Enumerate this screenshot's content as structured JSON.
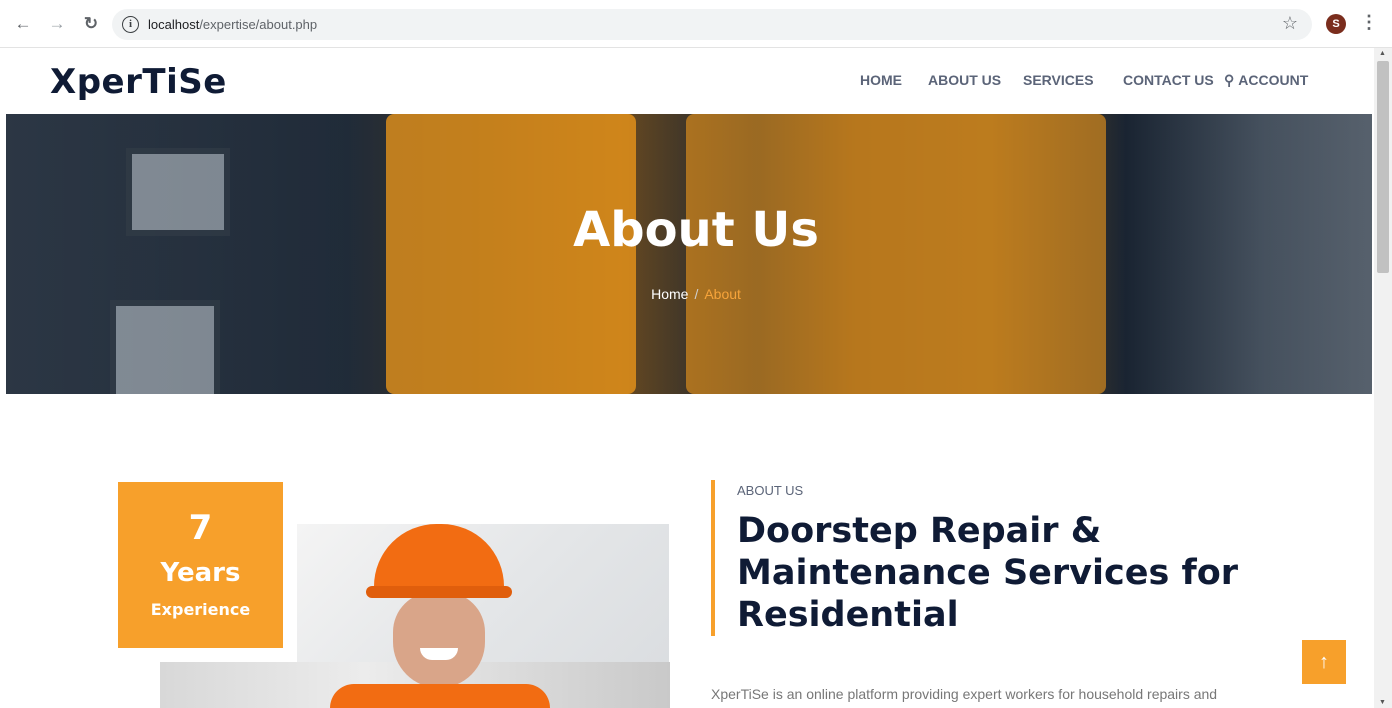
{
  "browser": {
    "url_host": "localhost",
    "url_path": "/expertise/about.php",
    "avatar_letter": "S"
  },
  "site": {
    "logo": "XperTiSe",
    "nav": {
      "home": "HOME",
      "about": "ABOUT US",
      "services": "SERVICES",
      "contact": "CONTACT US",
      "account": "ACCOUNT"
    }
  },
  "hero": {
    "title": "About Us",
    "breadcrumb_home": "Home",
    "breadcrumb_sep": "/",
    "breadcrumb_current": "About"
  },
  "about": {
    "experience_number": "7",
    "experience_years": "Years",
    "experience_label": "Experience",
    "eyebrow": "ABOUT US",
    "title": "Doorstep Repair & Maintenance Services for Residential",
    "text": "XperTiSe is an online platform providing expert workers for household repairs and"
  },
  "colors": {
    "accent": "#f7a02b",
    "navy": "#0f1b35",
    "nav_text": "#5b6478"
  },
  "icons": {
    "back": "arrow-left-icon",
    "forward": "arrow-right-icon",
    "reload": "reload-icon",
    "info": "info-icon",
    "star": "star-icon",
    "account": "user-icon",
    "to_top": "arrow-up-icon"
  }
}
